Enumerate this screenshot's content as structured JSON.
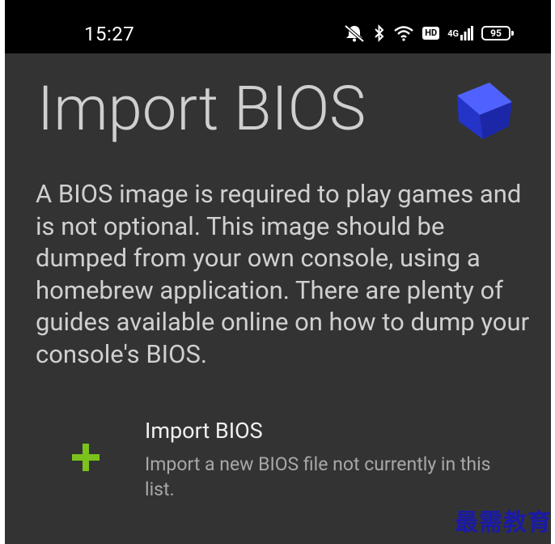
{
  "status_bar": {
    "time": "15:27",
    "hd_label": "HD",
    "network_label": "4G",
    "battery": "95"
  },
  "page": {
    "title": "Import BIOS",
    "description": "A BIOS image is required to play games and is not optional. This image should be dumped from your own console, using a homebrew application. There are plenty of guides available online on how to dump your console's BIOS."
  },
  "import_item": {
    "title": "Import BIOS",
    "subtitle": "Import a new BIOS file not currently in this list."
  },
  "watermark": "最需教育",
  "colors": {
    "background": "#333333",
    "status_bar": "#000000",
    "plus_icon": "#7cc21d",
    "cube": "#2f3fe0",
    "watermark": "#1a1aa8"
  },
  "icons": [
    "silent-mode-icon",
    "bluetooth-icon",
    "wifi-icon",
    "hd-icon",
    "cellular-signal-icon",
    "battery-icon",
    "cube-icon",
    "plus-icon"
  ]
}
